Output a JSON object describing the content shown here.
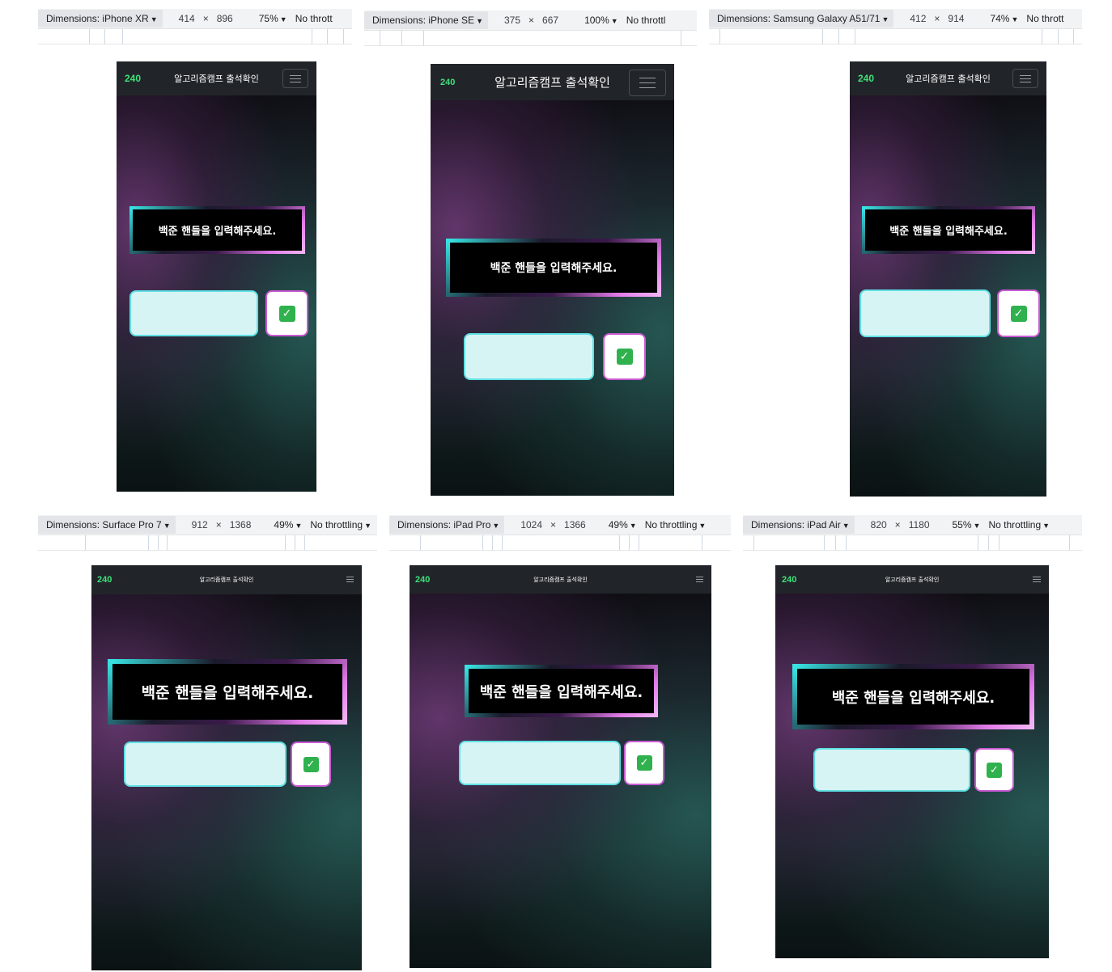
{
  "app": {
    "brand": "240",
    "title": "알고리즘캠프 출석확인",
    "prompt": "백준 핸들을 입력해주세요.",
    "input_value": "",
    "submit_icon": "✓"
  },
  "devices": [
    {
      "name": "Dimensions: iPhone XR",
      "width": "414",
      "height": "896",
      "zoom": "75%",
      "throttle": "No thrott"
    },
    {
      "name": "Dimensions: iPhone SE",
      "width": "375",
      "height": "667",
      "zoom": "100%",
      "throttle": "No throttl"
    },
    {
      "name": "Dimensions: Samsung Galaxy A51/71",
      "width": "412",
      "height": "914",
      "zoom": "74%",
      "throttle": "No thrott"
    },
    {
      "name": "Dimensions: Surface Pro 7",
      "width": "912",
      "height": "1368",
      "zoom": "49%",
      "throttle": "No throttling"
    },
    {
      "name": "Dimensions: iPad Pro",
      "width": "1024",
      "height": "1366",
      "zoom": "49%",
      "throttle": "No throttling"
    },
    {
      "name": "Dimensions: iPad Air",
      "width": "820",
      "height": "1180",
      "zoom": "55%",
      "throttle": "No throttling"
    }
  ],
  "colors": {
    "brand_green": "#3ee07a",
    "navbar_bg": "#212529",
    "input_bg": "#d7f4f4",
    "input_border": "#5fe0e4",
    "button_border": "#c95ad2",
    "check_green": "#2fb14d"
  }
}
